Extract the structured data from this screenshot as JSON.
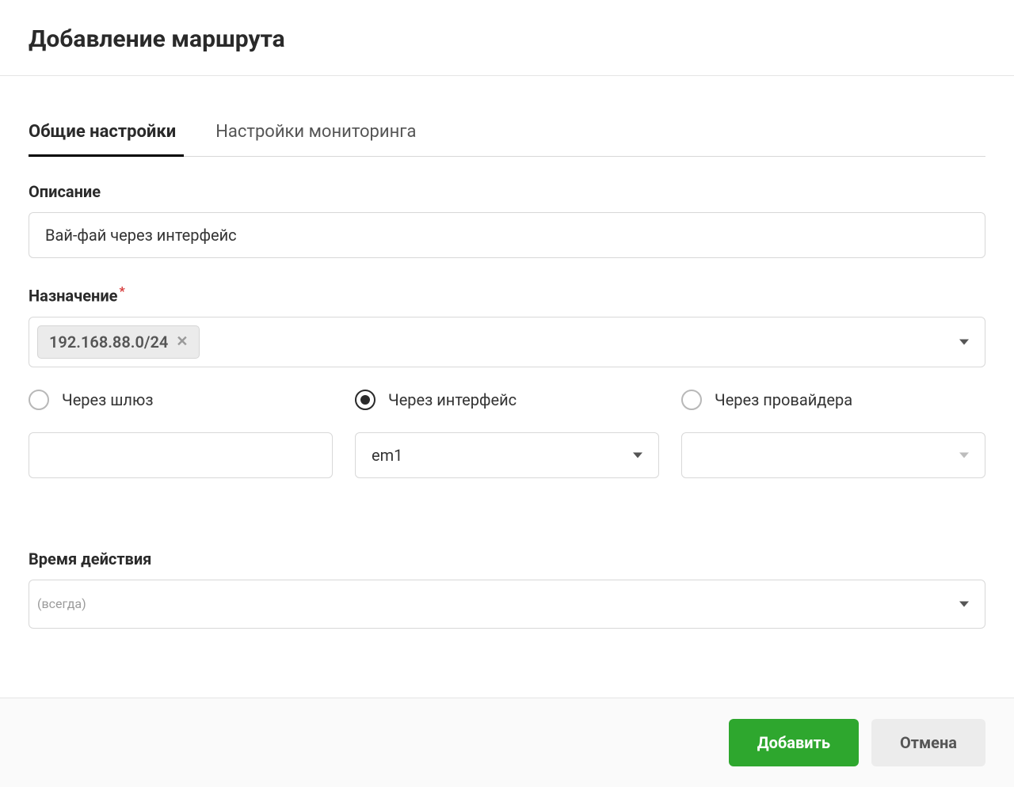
{
  "header": {
    "title": "Добавление маршрута"
  },
  "tabs": {
    "general": "Общие настройки",
    "monitoring": "Настройки мониторинга"
  },
  "form": {
    "description": {
      "label": "Описание",
      "value": "Вай-фай через интерфейс"
    },
    "destination": {
      "label": "Назначение",
      "tag": "192.168.88.0/24"
    },
    "via": {
      "gateway": {
        "label": "Через шлюз",
        "value": ""
      },
      "interface": {
        "label": "Через интерфейс",
        "value": "em1"
      },
      "provider": {
        "label": "Через провайдера",
        "value": ""
      },
      "selected": "interface"
    },
    "time": {
      "label": "Время действия",
      "placeholder": "(всегда)"
    }
  },
  "footer": {
    "submit": "Добавить",
    "cancel": "Отмена"
  }
}
